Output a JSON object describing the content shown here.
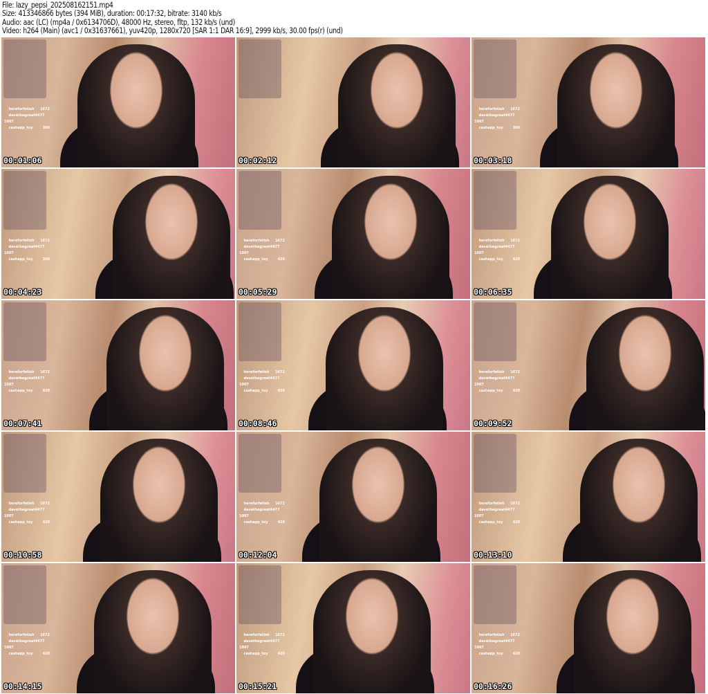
{
  "header": {
    "file": "File: lazy_pepsi_202508162151.mp4",
    "size": "Size: 413346866 bytes (394 MiB), duration: 00:17:32, bitrate: 3140 kb/s",
    "audio": "Audio: aac (LC) (mp4a / 0x6134706D), 48000 Hz, stereo, fltp, 132 kb/s (und)",
    "video": "Video: h264 (Main) (avc1 / 0x31637661), yuv420p, 1280x720 [SAR 1:1 DAR 16:9], 2999 kb/s, 30.00 fps(r) (und)"
  },
  "leaderboard_names": [
    "hereforfetish",
    "davethegreat4477 1007",
    "cashapp_toy"
  ],
  "frames": [
    {
      "time": "00:01:06",
      "scores": [
        "1672",
        "",
        "390"
      ]
    },
    {
      "time": "00:02:12",
      "scores": null
    },
    {
      "time": "00:03:18",
      "scores": [
        "1672",
        "",
        "390"
      ]
    },
    {
      "time": "00:04:23",
      "scores": [
        "1672",
        "",
        "390"
      ]
    },
    {
      "time": "00:05:29",
      "scores": [
        "1672",
        "",
        "420"
      ]
    },
    {
      "time": "00:06:35",
      "scores": [
        "1672",
        "",
        "420"
      ]
    },
    {
      "time": "00:07:41",
      "scores": [
        "1672",
        "",
        "420"
      ]
    },
    {
      "time": "00:08:46",
      "scores": [
        "1672",
        "",
        "420"
      ]
    },
    {
      "time": "00:09:52",
      "scores": [
        "1672",
        "",
        "420"
      ]
    },
    {
      "time": "00:10:58",
      "scores": [
        "1672",
        "",
        "420"
      ]
    },
    {
      "time": "00:12:04",
      "scores": [
        "1672",
        "",
        "420"
      ]
    },
    {
      "time": "00:13:10",
      "scores": [
        "1672",
        "",
        "420"
      ]
    },
    {
      "time": "00:14:15",
      "scores": [
        "1672",
        "",
        "420"
      ]
    },
    {
      "time": "00:15:21",
      "scores": [
        "1672",
        "",
        "420"
      ]
    },
    {
      "time": "00:16:26",
      "scores": [
        "1672",
        "",
        "420"
      ]
    }
  ]
}
